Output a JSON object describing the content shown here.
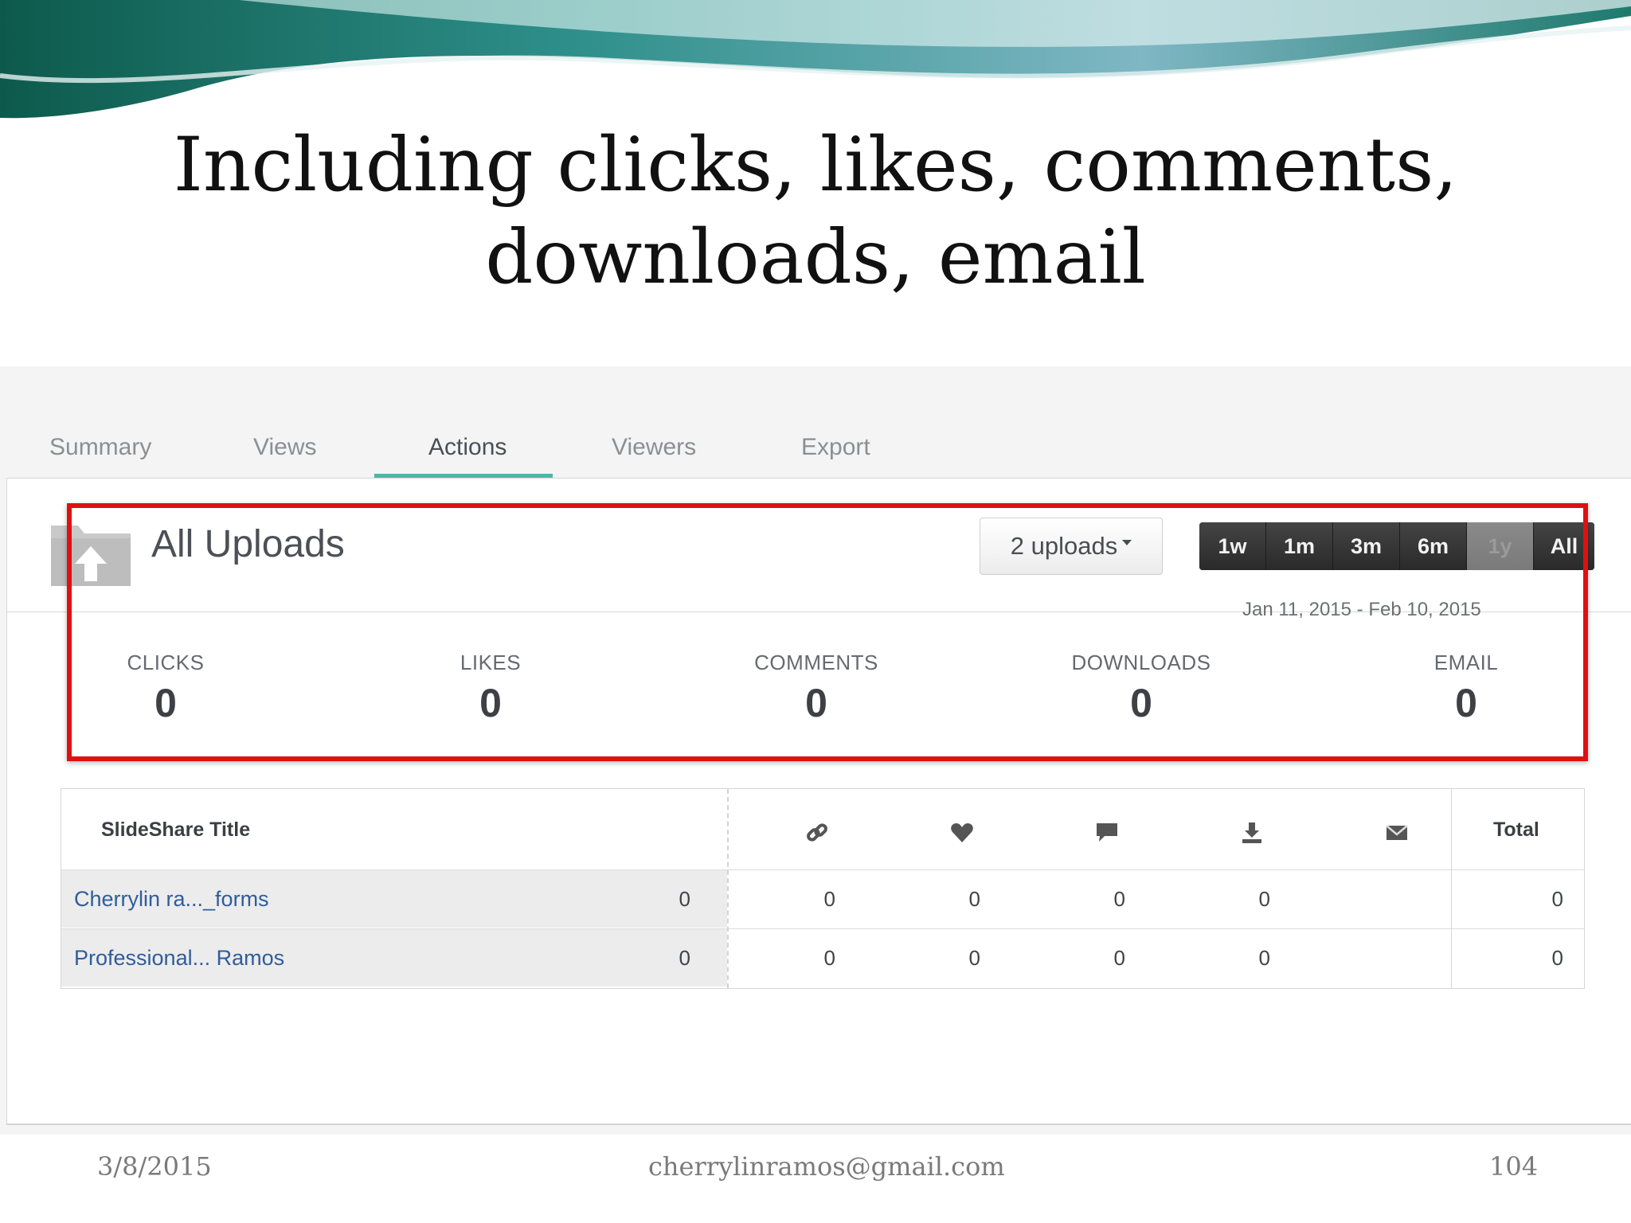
{
  "slide": {
    "title_line1": "Including clicks, likes, comments,",
    "title_line2": "downloads, email"
  },
  "tabs": [
    {
      "label": "Summary",
      "active": false
    },
    {
      "label": "Views",
      "active": false
    },
    {
      "label": "Actions",
      "active": true
    },
    {
      "label": "Viewers",
      "active": false
    },
    {
      "label": "Export",
      "active": false
    }
  ],
  "header": {
    "title": "All Uploads",
    "uploads_dropdown": "2 uploads",
    "range_buttons": [
      "1w",
      "1m",
      "3m",
      "6m",
      "1y",
      "All"
    ],
    "date_range": "Jan 11, 2015 - Feb 10, 2015"
  },
  "stats": [
    {
      "label": "CLICKS",
      "value": "0"
    },
    {
      "label": "LIKES",
      "value": "0"
    },
    {
      "label": "COMMENTS",
      "value": "0"
    },
    {
      "label": "DOWNLOADS",
      "value": "0"
    },
    {
      "label": "EMAIL",
      "value": "0"
    }
  ],
  "table": {
    "title_header": "SlideShare Title",
    "total_header": "Total",
    "column_icons": [
      "link-icon",
      "heart-icon",
      "comment-icon",
      "download-icon",
      "email-icon"
    ],
    "rows": [
      {
        "title": "Cherrylin ra..._forms",
        "values": [
          "0",
          "0",
          "0",
          "0",
          "0"
        ],
        "total": "0"
      },
      {
        "title": "Professional... Ramos",
        "values": [
          "0",
          "0",
          "0",
          "0",
          "0"
        ],
        "total": "0"
      }
    ]
  },
  "footer": {
    "date": "3/8/2015",
    "email": "cherrylinramos@gmail.com",
    "page": "104"
  },
  "colors": {
    "highlight_box": "#e01010",
    "active_tab_underline": "#4fb5a8",
    "link_text": "#2f5d9a"
  }
}
